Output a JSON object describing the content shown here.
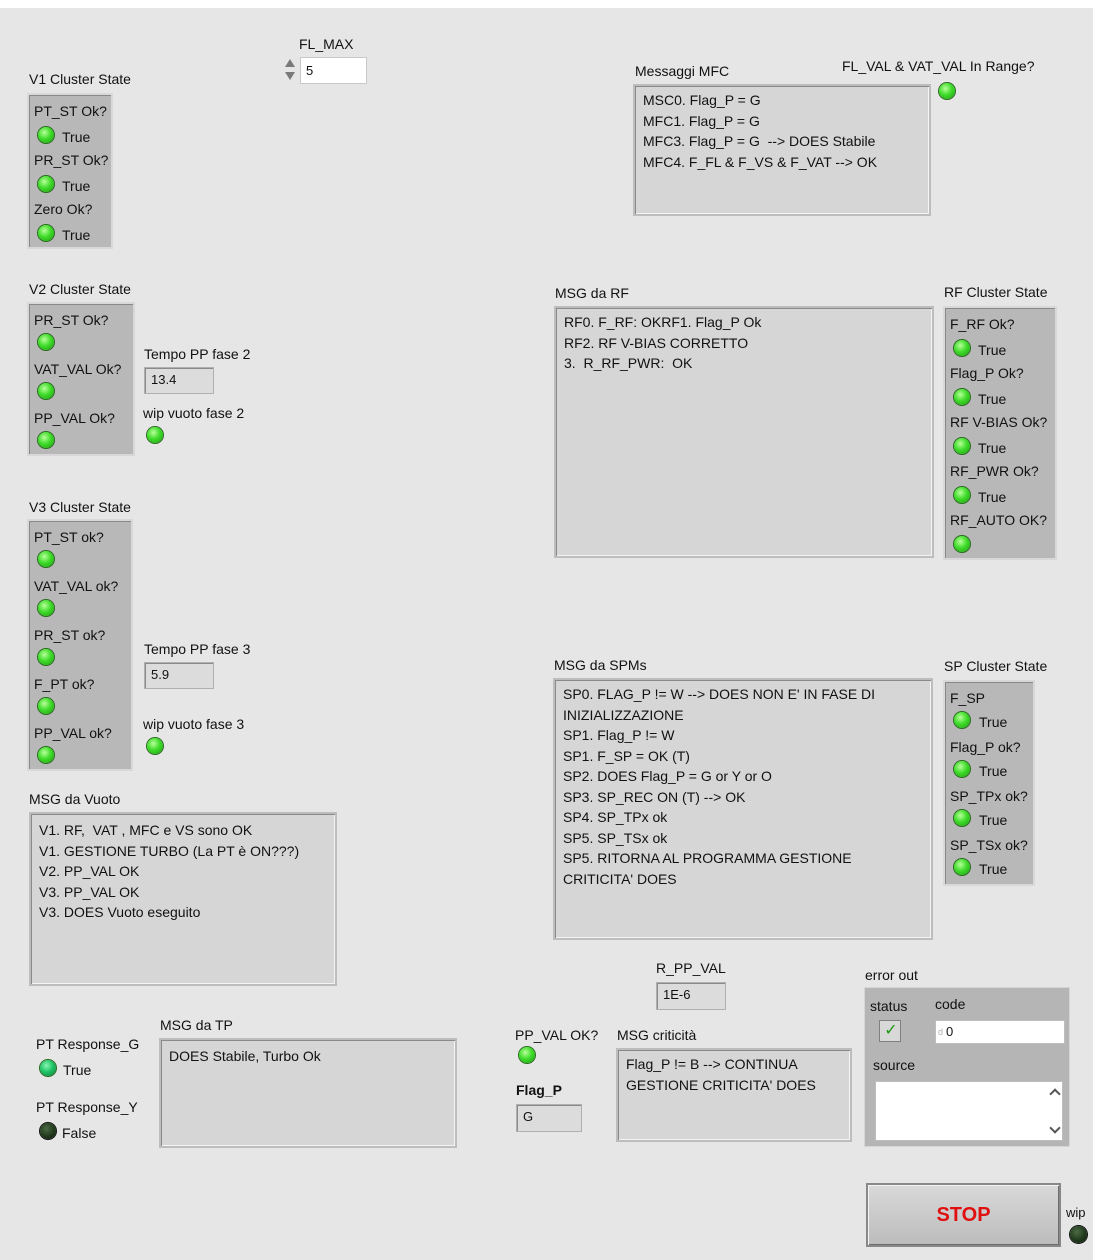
{
  "fl_max": {
    "label": "FL_MAX",
    "value": "5"
  },
  "v1": {
    "title": "V1 Cluster State",
    "items": [
      {
        "label": "PT_ST Ok?",
        "state": "True"
      },
      {
        "label": "PR_ST Ok?",
        "state": "True"
      },
      {
        "label": "Zero Ok?",
        "state": "True"
      }
    ]
  },
  "v2": {
    "title": "V2 Cluster State",
    "items": [
      {
        "label": "PR_ST Ok?"
      },
      {
        "label": "VAT_VAL Ok?"
      },
      {
        "label": "PP_VAL Ok?"
      }
    ],
    "tempo_label": "Tempo PP fase 2",
    "tempo_value": "13.4",
    "wip_label": "wip vuoto fase 2"
  },
  "v3": {
    "title": "V3 Cluster State",
    "items": [
      {
        "label": "PT_ST ok?"
      },
      {
        "label": "VAT_VAL ok?"
      },
      {
        "label": "PR_ST ok?"
      },
      {
        "label": "F_PT ok?"
      },
      {
        "label": "PP_VAL ok?"
      }
    ],
    "tempo_label": "Tempo PP fase 3",
    "tempo_value": "5.9",
    "wip_label": "wip vuoto fase 3"
  },
  "vuoto": {
    "title": "MSG da Vuoto",
    "text": "V1. RF,  VAT , MFC e VS sono OK\nV1. GESTIONE TURBO (La PT è ON???)\nV2. PP_VAL OK\nV3. PP_VAL OK\nV3. DOES Vuoto eseguito"
  },
  "pt_response": {
    "g_label": "PT Response_G",
    "g_state": "True",
    "y_label": "PT Response_Y",
    "y_state": "False"
  },
  "tp": {
    "title": "MSG da TP",
    "text": "DOES Stabile, Turbo Ok"
  },
  "mfc": {
    "title": "Messaggi MFC",
    "text": "MSC0. Flag_P = G\nMFC1. Flag_P = G\nMFC3. Flag_P = G  --> DOES Stabile\nMFC4. F_FL & F_VS & F_VAT --> OK",
    "range_label": "FL_VAL & VAT_VAL In Range?"
  },
  "rf": {
    "title": "MSG da RF",
    "text": "RF0. F_RF: OKRF1. Flag_P Ok\nRF2. RF V-BIAS CORRETTO\n3.  R_RF_PWR:  OK",
    "cluster_title": "RF Cluster State",
    "items": [
      {
        "label": "F_RF Ok?",
        "state": "True"
      },
      {
        "label": "Flag_P Ok?",
        "state": "True"
      },
      {
        "label": "RF V-BIAS Ok?",
        "state": "True"
      },
      {
        "label": "RF_PWR Ok?",
        "state": "True"
      },
      {
        "label": "RF_AUTO OK?"
      }
    ]
  },
  "sp": {
    "title": "MSG da SPMs",
    "text": "SP0. FLAG_P != W --> DOES NON E' IN FASE DI INIZIALIZZAZIONE\nSP1. Flag_P != W\nSP1. F_SP = OK (T)\nSP2. DOES Flag_P = G or Y or O\nSP3. SP_REC ON (T) --> OK\nSP4. SP_TPx ok\nSP5. SP_TSx ok\nSP5. RITORNA AL PROGRAMMA GESTIONE CRITICITA' DOES",
    "cluster_title": "SP Cluster State",
    "items": [
      {
        "label": "F_SP",
        "state": "True"
      },
      {
        "label": "Flag_P ok?",
        "state": "True"
      },
      {
        "label": "SP_TPx ok?",
        "state": "True"
      },
      {
        "label": "SP_TSx ok?",
        "state": "True"
      }
    ]
  },
  "r_pp_val": {
    "label": "R_PP_VAL",
    "value": "1E-6"
  },
  "pp_val_ok": {
    "label": "PP_VAL OK?"
  },
  "flag_p": {
    "label": "Flag_P",
    "value": "G"
  },
  "criticita": {
    "title": "MSG criticità",
    "text": "Flag_P != B --> CONTINUA GESTIONE CRITICITA' DOES"
  },
  "error_out": {
    "title": "error out",
    "status_label": "status",
    "code_label": "code",
    "code_value": "0",
    "source_label": "source",
    "source_value": ""
  },
  "stop": {
    "label": "STOP",
    "wip_label": "wip"
  },
  "colors": {
    "led_on": "#3fdc2a",
    "led_off": "#203a1b",
    "stop_text": "#e01010",
    "background": "#e6e6e6"
  }
}
